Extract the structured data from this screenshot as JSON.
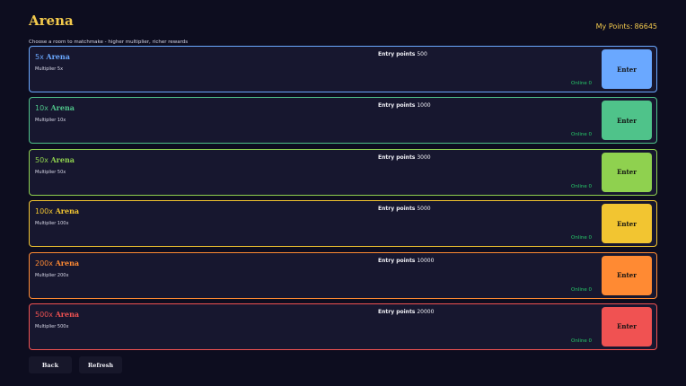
{
  "header": {
    "title": "Arena",
    "subtitle": "Choose a room to matchmake - higher multiplier, richer rewards",
    "points_label": "My Points:",
    "points_value": "86645"
  },
  "rooms": [
    {
      "name_mult": "5x",
      "name_word": "Arena",
      "multiplier_text": "Multiplier 5x",
      "entry_label": "Entry points",
      "entry_value": "500",
      "online_text": "Online 0",
      "enter_label": "Enter",
      "color": "#6aa8ff"
    },
    {
      "name_mult": "10x",
      "name_word": "Arena",
      "multiplier_text": "Multiplier 10x",
      "entry_label": "Entry points",
      "entry_value": "1000",
      "online_text": "Online 0",
      "enter_label": "Enter",
      "color": "#4fc38a"
    },
    {
      "name_mult": "50x",
      "name_word": "Arena",
      "multiplier_text": "Multiplier 50x",
      "entry_label": "Entry points",
      "entry_value": "3000",
      "online_text": "Online 0",
      "enter_label": "Enter",
      "color": "#8fd14f"
    },
    {
      "name_mult": "100x",
      "name_word": "Arena",
      "multiplier_text": "Multiplier 100x",
      "entry_label": "Entry points",
      "entry_value": "5000",
      "online_text": "Online 0",
      "enter_label": "Enter",
      "color": "#f2c531"
    },
    {
      "name_mult": "200x",
      "name_word": "Arena",
      "multiplier_text": "Multiplier 200x",
      "entry_label": "Entry points",
      "entry_value": "10000",
      "online_text": "Online 0",
      "enter_label": "Enter",
      "color": "#ff8a33"
    },
    {
      "name_mult": "500x",
      "name_word": "Arena",
      "multiplier_text": "Multiplier 500x",
      "entry_label": "Entry points",
      "entry_value": "20000",
      "online_text": "Online 0",
      "enter_label": "Enter",
      "color": "#f05252"
    }
  ],
  "footer": {
    "back_label": "Back",
    "refresh_label": "Refresh"
  }
}
